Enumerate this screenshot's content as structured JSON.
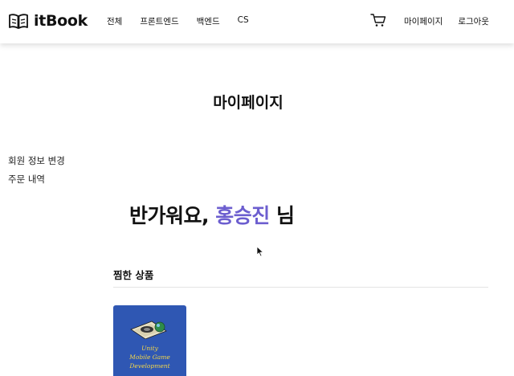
{
  "header": {
    "logo_text": "itBook",
    "nav": [
      "전체",
      "프론트엔드",
      "백엔드",
      "CS"
    ],
    "cart_icon": "cart-icon",
    "mypage_label": "마이페이지",
    "logout_label": "로그아웃"
  },
  "page": {
    "title": "마이페이지"
  },
  "sidebar": {
    "items": [
      "회원 정보 변경",
      "주문 내역"
    ]
  },
  "greeting": {
    "prefix": "반가워요,",
    "user_name": "홍승진",
    "suffix": "님"
  },
  "wishlist": {
    "title": "찜한 상품",
    "books": [
      {
        "cover_lines": [
          "Unity",
          "Mobile Game",
          "Development"
        ]
      }
    ]
  },
  "colors": {
    "accent": "#6c5ecf",
    "book_cover": "#2f57b3",
    "book_text": "#f3d64a"
  }
}
